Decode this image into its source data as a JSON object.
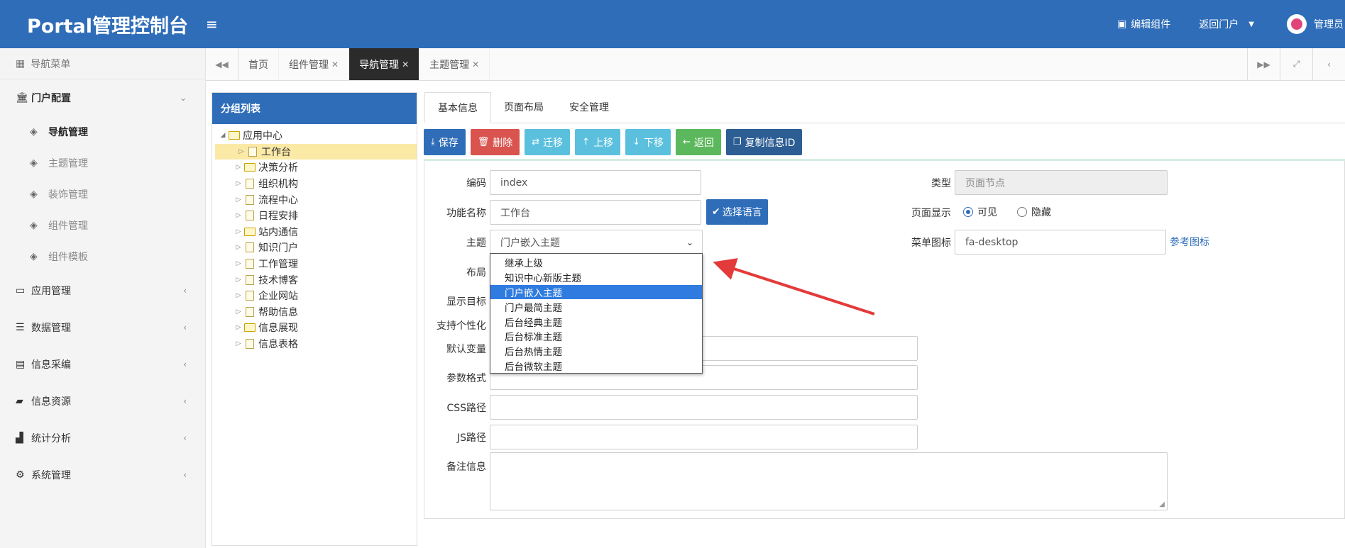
{
  "header": {
    "brand": "Portal管理控制台",
    "menu_icon": "hamburger-icon",
    "edit_widget": "编辑组件",
    "back_portal": "返回门户",
    "user": "管理员"
  },
  "sidebar": {
    "title": "导航菜单",
    "groups": [
      {
        "label": "门户配置",
        "icon": "bank-icon",
        "expanded": true,
        "items": [
          {
            "label": "导航管理",
            "active": true
          },
          {
            "label": "主题管理"
          },
          {
            "label": "装饰管理"
          },
          {
            "label": "组件管理"
          },
          {
            "label": "组件模板"
          }
        ]
      },
      {
        "label": "应用管理",
        "icon": "laptop-icon"
      },
      {
        "label": "数据管理",
        "icon": "list-icon"
      },
      {
        "label": "信息采编",
        "icon": "newspaper-icon"
      },
      {
        "label": "信息资源",
        "icon": "book-icon"
      },
      {
        "label": "统计分析",
        "icon": "chart-icon"
      },
      {
        "label": "系统管理",
        "icon": "gears-icon"
      }
    ]
  },
  "tabs": [
    {
      "label": "首页",
      "closable": false
    },
    {
      "label": "组件管理",
      "closable": true
    },
    {
      "label": "导航管理",
      "closable": true,
      "active": true
    },
    {
      "label": "主题管理",
      "closable": true
    }
  ],
  "group_panel": {
    "title": "分组列表",
    "root": "应用中心",
    "children": [
      {
        "label": "工作台",
        "type": "page",
        "selected": true
      },
      {
        "label": "决策分析",
        "type": "folder"
      },
      {
        "label": "组织机构",
        "type": "page"
      },
      {
        "label": "流程中心",
        "type": "page"
      },
      {
        "label": "日程安排",
        "type": "page"
      },
      {
        "label": "站内通信",
        "type": "folder"
      },
      {
        "label": "知识门户",
        "type": "page"
      },
      {
        "label": "工作管理",
        "type": "page"
      },
      {
        "label": "技术博客",
        "type": "page"
      },
      {
        "label": "企业网站",
        "type": "page"
      },
      {
        "label": "帮助信息",
        "type": "page"
      },
      {
        "label": "信息展现",
        "type": "folder"
      },
      {
        "label": "信息表格",
        "type": "page"
      }
    ]
  },
  "content_tabs": [
    "基本信息",
    "页面布局",
    "安全管理"
  ],
  "toolbar": {
    "save": "保存",
    "delete": "删除",
    "move": "迁移",
    "up": "上移",
    "down": "下移",
    "back": "返回",
    "copy_id": "复制信息ID"
  },
  "form": {
    "code_label": "编码",
    "code_value": "index",
    "name_label": "功能名称",
    "name_value": "工作台",
    "lang_button": "选择语言",
    "theme_label": "主题",
    "theme_value": "门户嵌入主题",
    "layout_label": "布局",
    "target_label": "显示目标",
    "personal_label": "支持个性化",
    "var_label": "默认变量",
    "param_label": "参数格式",
    "css_label": "CSS路径",
    "js_label": "JS路径",
    "remark_label": "备注信息",
    "type_label": "类型",
    "type_value": "页面节点",
    "display_label": "页面显示",
    "visible_label": "可见",
    "hidden_label": "隐藏",
    "display_selected": "可见",
    "menu_icon_label": "菜单图标",
    "menu_icon_value": "fa-desktop",
    "ref_icon_link": "参考图标"
  },
  "theme_options": [
    {
      "label": "继承上级"
    },
    {
      "label": "知识中心新版主题"
    },
    {
      "label": "门户嵌入主题",
      "highlighted": true
    },
    {
      "label": "门户最简主题"
    },
    {
      "label": "后台经典主题"
    },
    {
      "label": "后台标准主题"
    },
    {
      "label": "后台热情主题"
    },
    {
      "label": "后台微软主题"
    }
  ],
  "colors": {
    "primary": "#2f6db8",
    "danger": "#d9534f",
    "info": "#5bc0de",
    "success": "#5cb85c",
    "arrow": "#e33a3a"
  }
}
